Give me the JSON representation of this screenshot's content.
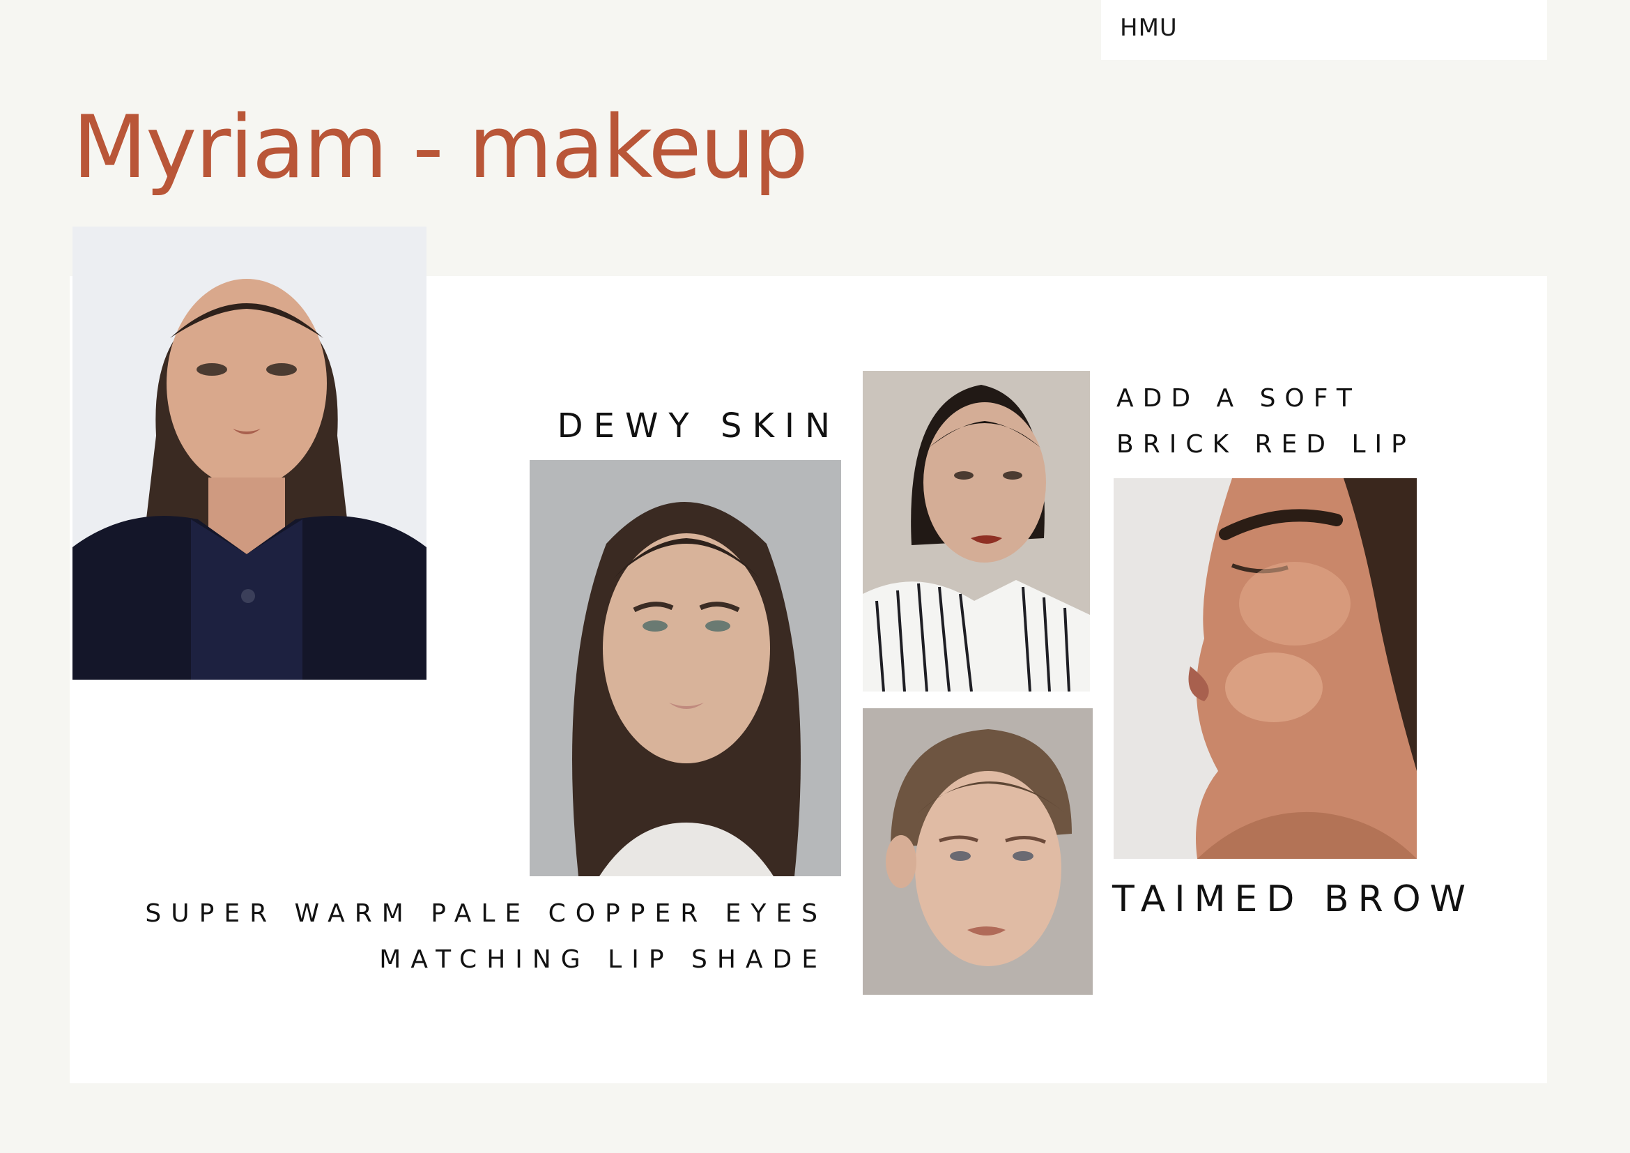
{
  "header": {
    "tag": "HMU"
  },
  "page": {
    "title": "Myriam - makeup"
  },
  "captions": {
    "dewy_skin": "DEWY SKIN",
    "soft_lip_line1": "ADD A SOFT",
    "soft_lip_line2": "BRICK RED LIP",
    "copper_eyes_line1": "SUPER WARM PALE COPPER EYES",
    "copper_eyes_line2": "MATCHING LIP SHADE",
    "brow": "TAIMED BROW"
  },
  "colors": {
    "page_background": "#f6f6f2",
    "board_background": "#ffffff",
    "title_accent": "#b95638",
    "caption_text": "#111111"
  },
  "photos": [
    {
      "name": "model-portrait-navy-coat"
    },
    {
      "name": "dewy-skin-reference"
    },
    {
      "name": "brick-red-lip-reference"
    },
    {
      "name": "copper-eyes-reference"
    },
    {
      "name": "tamed-brow-profile-reference"
    }
  ]
}
